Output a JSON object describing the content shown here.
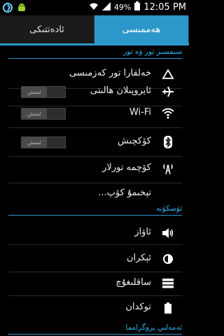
{
  "status_bar": {
    "battery_percent": "49%",
    "time": "12:05 PM"
  },
  "tabs": [
    {
      "label": "ھەممىسى",
      "active": true
    },
    {
      "label": "ئادەتتىكى",
      "active": false
    }
  ],
  "sections": {
    "wireless": "سىمسىز تور ۋە تور",
    "device": "ئۈسكۈنە",
    "apps": "ئەمەلىي پروگرامما"
  },
  "wireless_items": [
    {
      "label": "خەلقارا تور كەزمىسى",
      "icon": "triangle-icon"
    },
    {
      "label": "ئايروپىلان ھالىتى",
      "icon": "airplane-icon",
      "toggle": "ئىتىش"
    },
    {
      "label": "Wi-Fi",
      "icon": "wifi-icon",
      "toggle": "ئىتىش"
    },
    {
      "label": "كۆكچىش",
      "icon": "bluetooth-icon",
      "toggle": "ئىتىش"
    },
    {
      "label": "كۆچمە تورلار",
      "icon": "signal-tower-icon"
    },
    {
      "label": "تېخىمۇ كۆپ..."
    }
  ],
  "device_items": [
    {
      "label": "ئاۋاز",
      "icon": "speaker-icon"
    },
    {
      "label": "ئېكران",
      "icon": "display-brightness-icon"
    },
    {
      "label": "ساقلىغۇچ",
      "icon": "storage-icon"
    },
    {
      "label": "توكدان",
      "icon": "battery-icon"
    }
  ],
  "colors": {
    "accent": "#2c97c9",
    "section_text": "#2fb2f0"
  }
}
